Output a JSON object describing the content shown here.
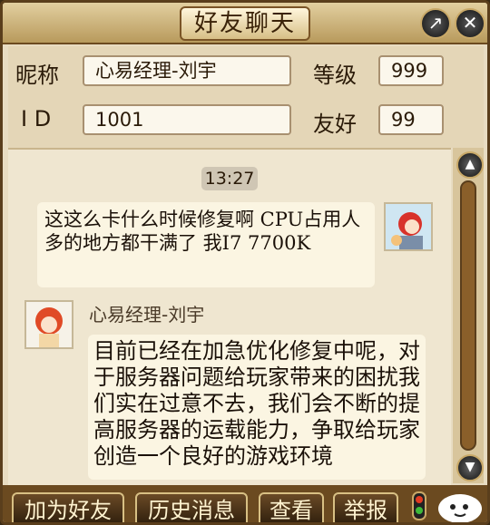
{
  "window": {
    "title": "好友聊天"
  },
  "titlebar": {
    "popout_glyph": "↗",
    "close_glyph": "✕"
  },
  "info": {
    "nickname_label": "昵称",
    "nickname_value": "心易经理-刘宇",
    "level_label": "等级",
    "level_value": "999",
    "id_label": "I D",
    "id_value": "1001",
    "friendship_label": "友好",
    "friendship_value": "99"
  },
  "chat": {
    "timestamp": "13:27",
    "messages": [
      {
        "from": "self",
        "text": "这这么卡什么时候修复啊 CPU占用人多的地方都干满了 我I7 7700K"
      },
      {
        "from": "other",
        "sender": "心易经理-刘宇",
        "text": "目前已经在加急优化修复中呢，对于服务器问题给玩家带来的困扰我们实在过意不去，我们会不断的提高服务器的运载能力，争取给玩家创造一个良好的游戏环境"
      }
    ]
  },
  "scrollbar": {
    "up_glyph": "▲",
    "down_glyph": "▼"
  },
  "buttons": {
    "add_friend": "加为好友",
    "history": "历史消息",
    "view": "查看",
    "report": "举报"
  },
  "colors": {
    "window_bg": "#e8dcc2",
    "frame": "#5a3e1c",
    "button_bg": "#3e2a12",
    "button_text": "#fff3d0"
  }
}
